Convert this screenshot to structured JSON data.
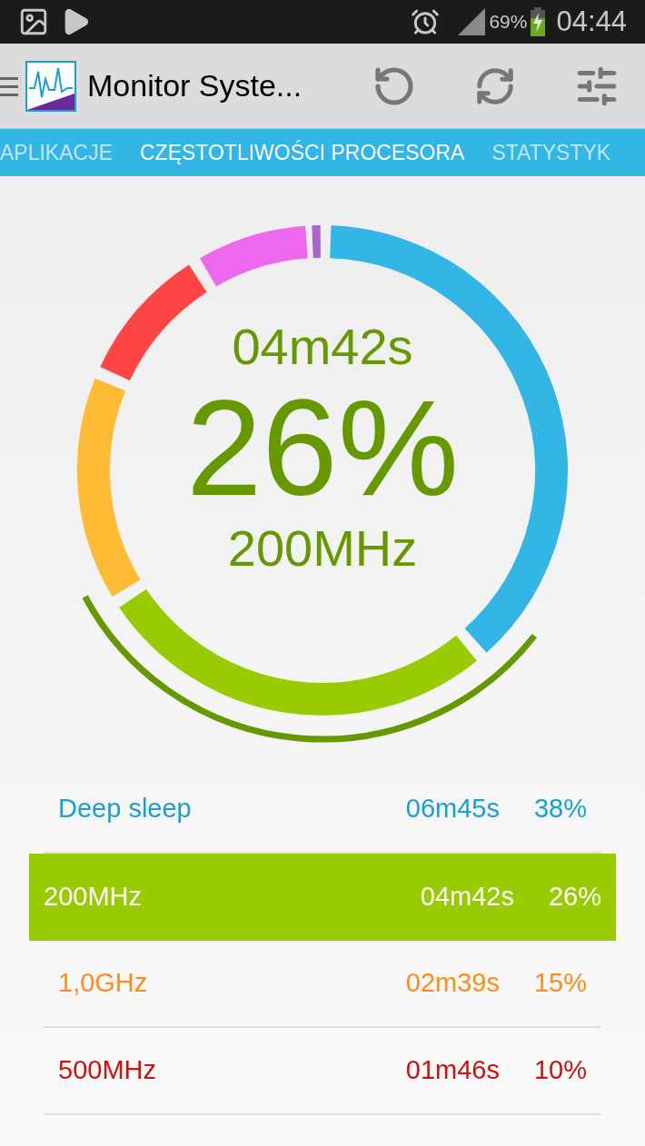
{
  "status_bar": {
    "battery": "69%",
    "time": "04:44"
  },
  "app_bar": {
    "title": "Monitor Syste..."
  },
  "tabs": [
    {
      "label": "APLIKACJE",
      "selected": false
    },
    {
      "label": "CZĘSTOTLIWOŚCI PROCESORA",
      "selected": true
    },
    {
      "label": "STATYSTYK",
      "selected": false
    }
  ],
  "summary": {
    "duration": "04m42s",
    "percent": "26%",
    "frequency": "200MHz"
  },
  "rows": [
    {
      "label": "Deep sleep",
      "time": "06m45s",
      "percent": "38%",
      "color": "#1a9fd4",
      "selected": false
    },
    {
      "label": "200MHz",
      "time": "04m42s",
      "percent": "26%",
      "color": "#99cc00",
      "selected": true
    },
    {
      "label": "1,0GHz",
      "time": "02m39s",
      "percent": "15%",
      "color": "#ff8c1a",
      "selected": false
    },
    {
      "label": "500MHz",
      "time": "01m46s",
      "percent": "10%",
      "color": "#cc1111",
      "selected": false
    }
  ]
}
